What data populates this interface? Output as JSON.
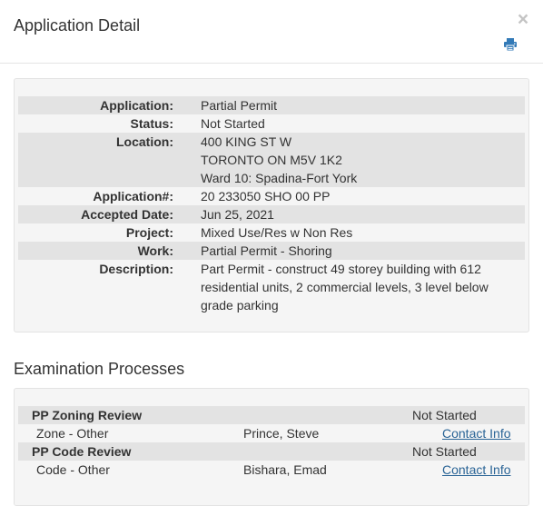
{
  "modal": {
    "title": "Application Detail",
    "close_label": "×",
    "print_icon": "print-icon"
  },
  "detail": {
    "application_label": "Application:",
    "application": "Partial Permit",
    "status_label": "Status:",
    "status": "Not Started",
    "location_label": "Location:",
    "location": [
      "400 KING ST W",
      "TORONTO ON M5V 1K2",
      "Ward 10: Spadina-Fort York"
    ],
    "app_no_label": "Application#:",
    "app_no": "20 233050 SHO 00 PP",
    "accepted_label": "Accepted Date:",
    "accepted": "Jun 25, 2021",
    "project_label": "Project:",
    "project": "Mixed Use/Res w Non Res",
    "work_label": "Work:",
    "work": "Partial Permit - Shoring",
    "description_label": "Description:",
    "description": "Part Permit - construct 49 storey building with 612 residential units, 2 commercial levels, 3 level below grade parking"
  },
  "exam": {
    "title": "Examination Processes",
    "processes": [
      {
        "name": "PP Zoning Review",
        "status": "Not Started",
        "task": "Zone - Other",
        "examiner": "Prince, Steve",
        "link": "Contact Info"
      },
      {
        "name": "PP Code Review",
        "status": "Not Started",
        "task": "Code - Other",
        "examiner": "Bishara, Emad",
        "link": "Contact Info"
      }
    ]
  }
}
